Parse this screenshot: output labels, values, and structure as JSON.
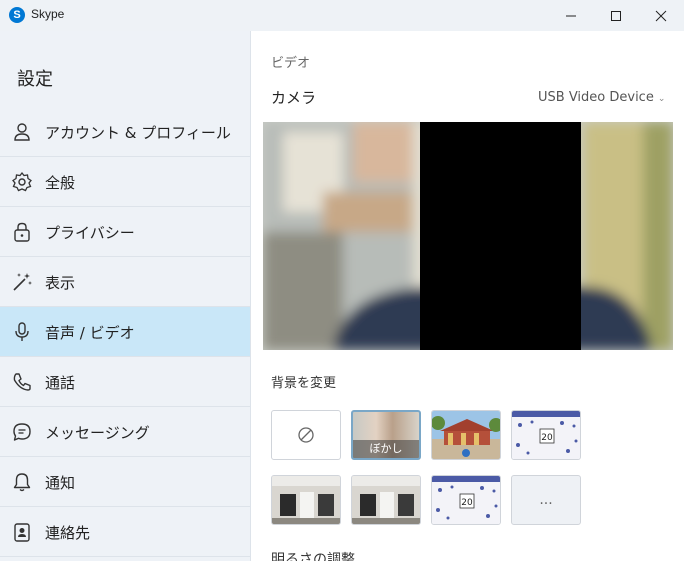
{
  "window": {
    "app_logo_letter": "S",
    "title": "Skype",
    "controls": [
      "minimize",
      "maximize",
      "close"
    ]
  },
  "sidebar": {
    "title": "設定",
    "items": [
      {
        "label": "アカウント & プロフィール",
        "icon": "person-icon",
        "active": false
      },
      {
        "label": "全般",
        "icon": "gear-icon",
        "active": false
      },
      {
        "label": "プライバシー",
        "icon": "lock-icon",
        "active": false
      },
      {
        "label": "表示",
        "icon": "magic-wand-icon",
        "active": false
      },
      {
        "label": "音声 / ビデオ",
        "icon": "microphone-icon",
        "active": true
      },
      {
        "label": "通話",
        "icon": "phone-icon",
        "active": false
      },
      {
        "label": "メッセージング",
        "icon": "chat-bubble-icon",
        "active": false
      },
      {
        "label": "通知",
        "icon": "bell-icon",
        "active": false
      },
      {
        "label": "連絡先",
        "icon": "contact-card-icon",
        "active": false
      }
    ]
  },
  "main": {
    "section_label": "ビデオ",
    "camera_label": "カメラ",
    "camera_device": "USB Video Device",
    "background_label": "背景を変更",
    "backgrounds": [
      {
        "kind": "none",
        "caption": ""
      },
      {
        "kind": "blur",
        "caption": "ぼかし",
        "selected": true
      },
      {
        "kind": "image-temple",
        "caption": ""
      },
      {
        "kind": "image-snowflake",
        "caption": ""
      },
      {
        "kind": "image-room",
        "caption": ""
      },
      {
        "kind": "image-room",
        "caption": ""
      },
      {
        "kind": "image-snowflake",
        "caption": ""
      },
      {
        "kind": "more",
        "caption": "..."
      }
    ],
    "brightness_label": "明るさの調整"
  },
  "colors": {
    "active_nav": "#c9e7f8",
    "sidebar_bg": "#eef2f7",
    "accent": "#0078d4"
  }
}
